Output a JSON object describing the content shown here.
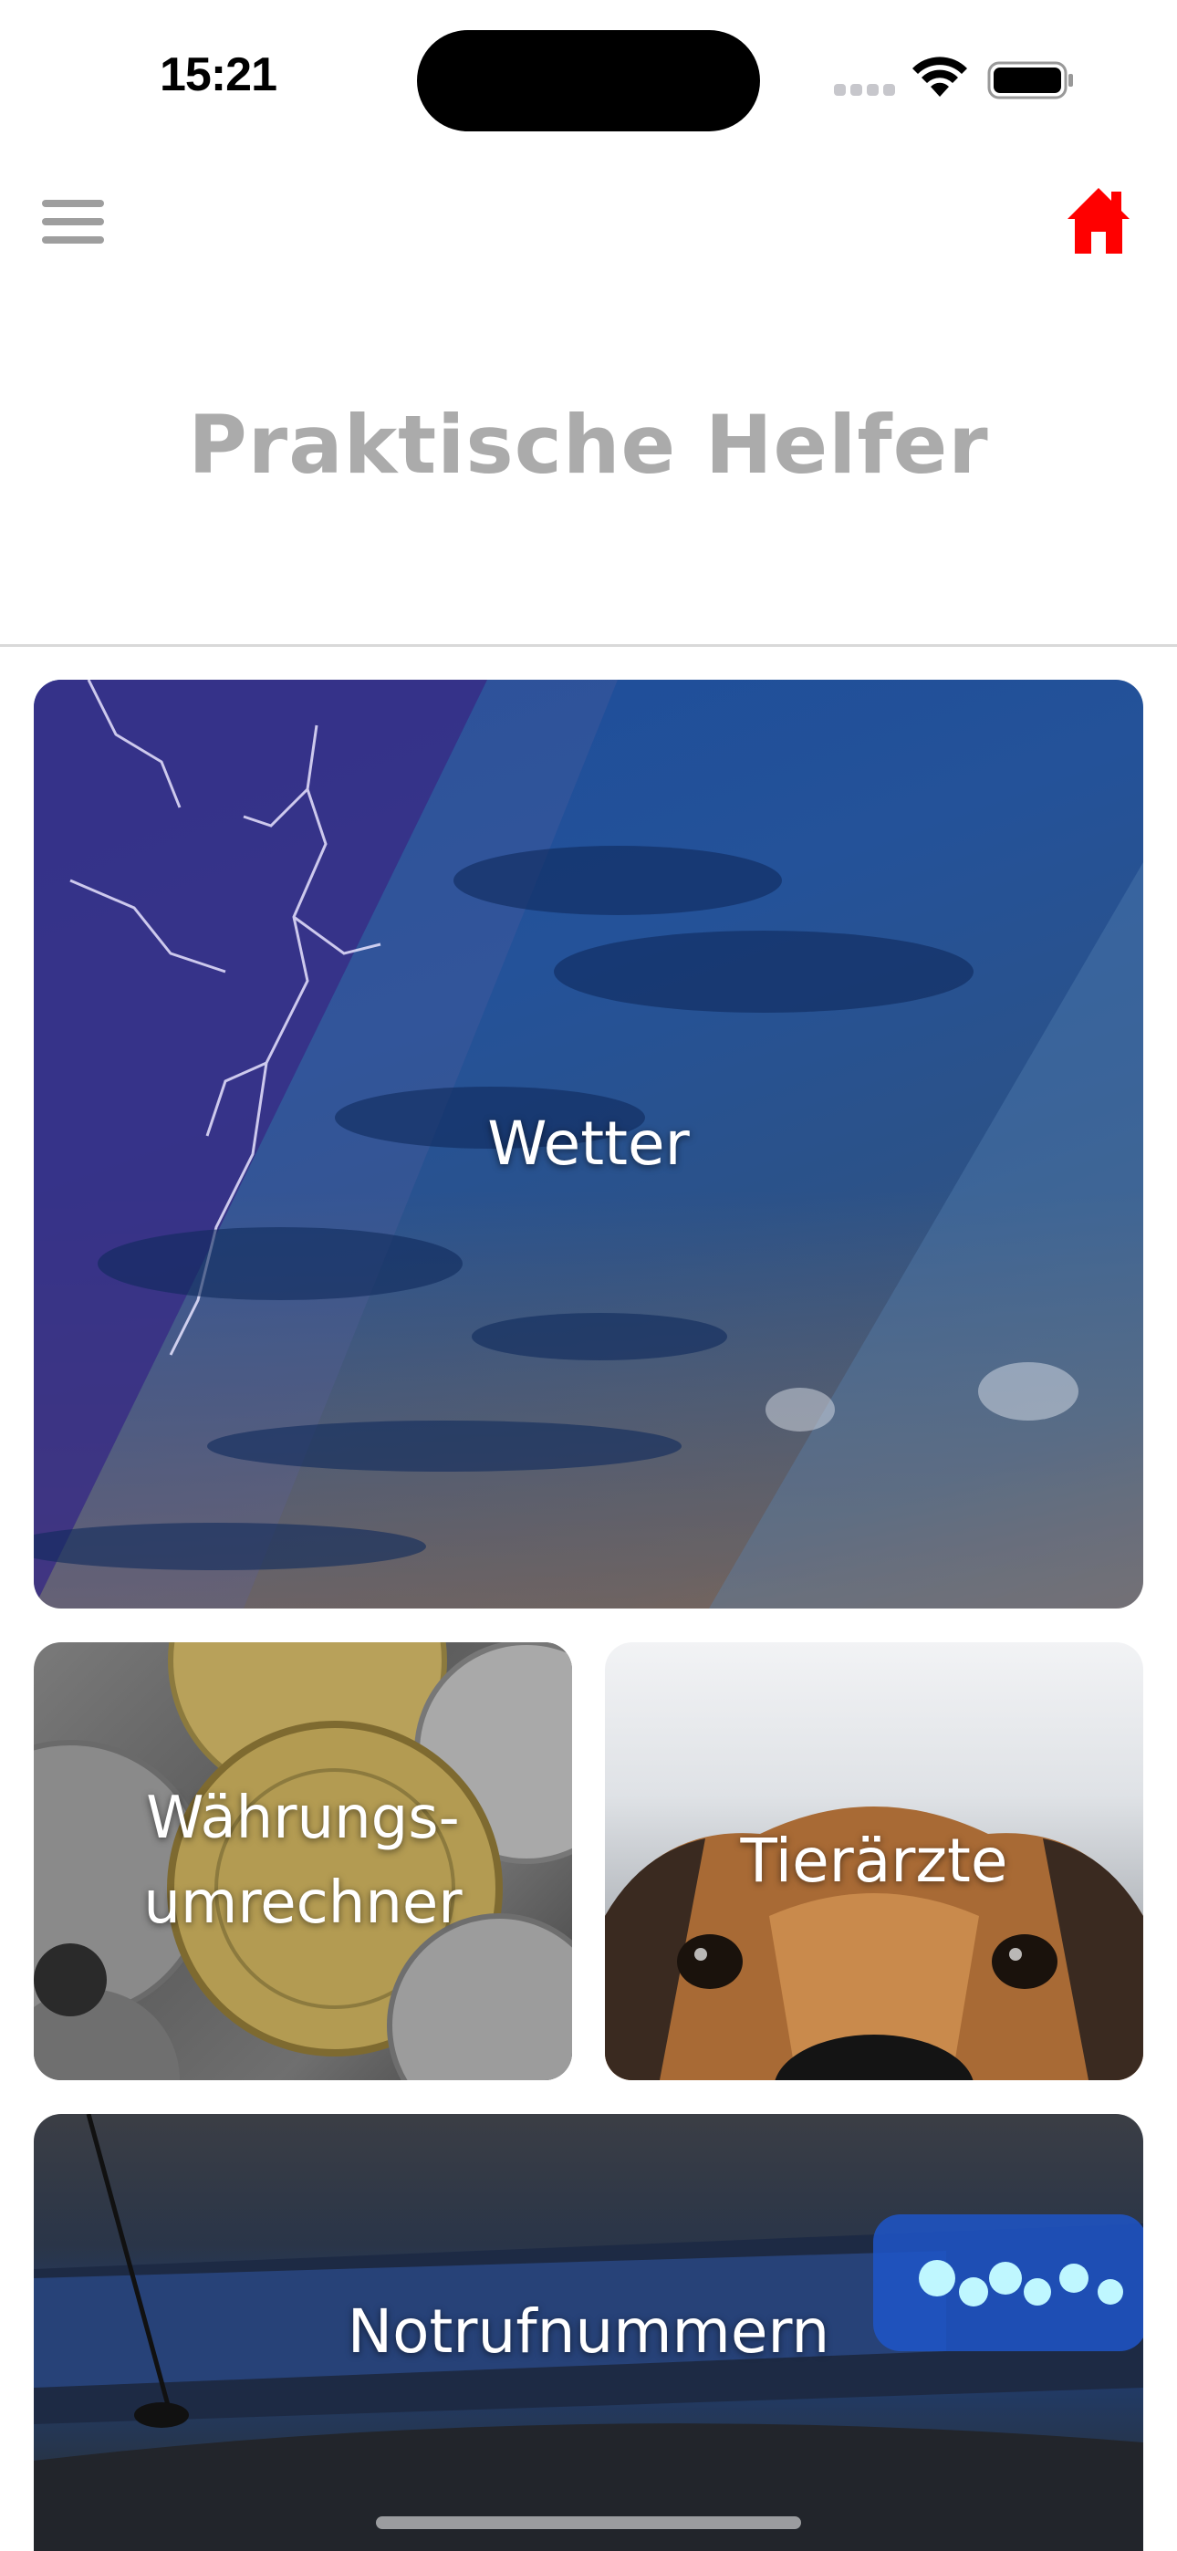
{
  "status_bar": {
    "time": "15:21"
  },
  "nav": {
    "menu_icon": "hamburger-menu-icon",
    "home_icon": "home-icon",
    "home_color": "#ff0000"
  },
  "page": {
    "title": "Praktische Helfer"
  },
  "tiles": [
    {
      "label": "Wetter",
      "image": "stormy-sky-image"
    },
    {
      "label": "Währungs-\numrechner",
      "image": "coins-image"
    },
    {
      "label": "Tierärzte",
      "image": "dog-image"
    },
    {
      "label": "Notrufnummern",
      "image": "police-light-image"
    }
  ]
}
